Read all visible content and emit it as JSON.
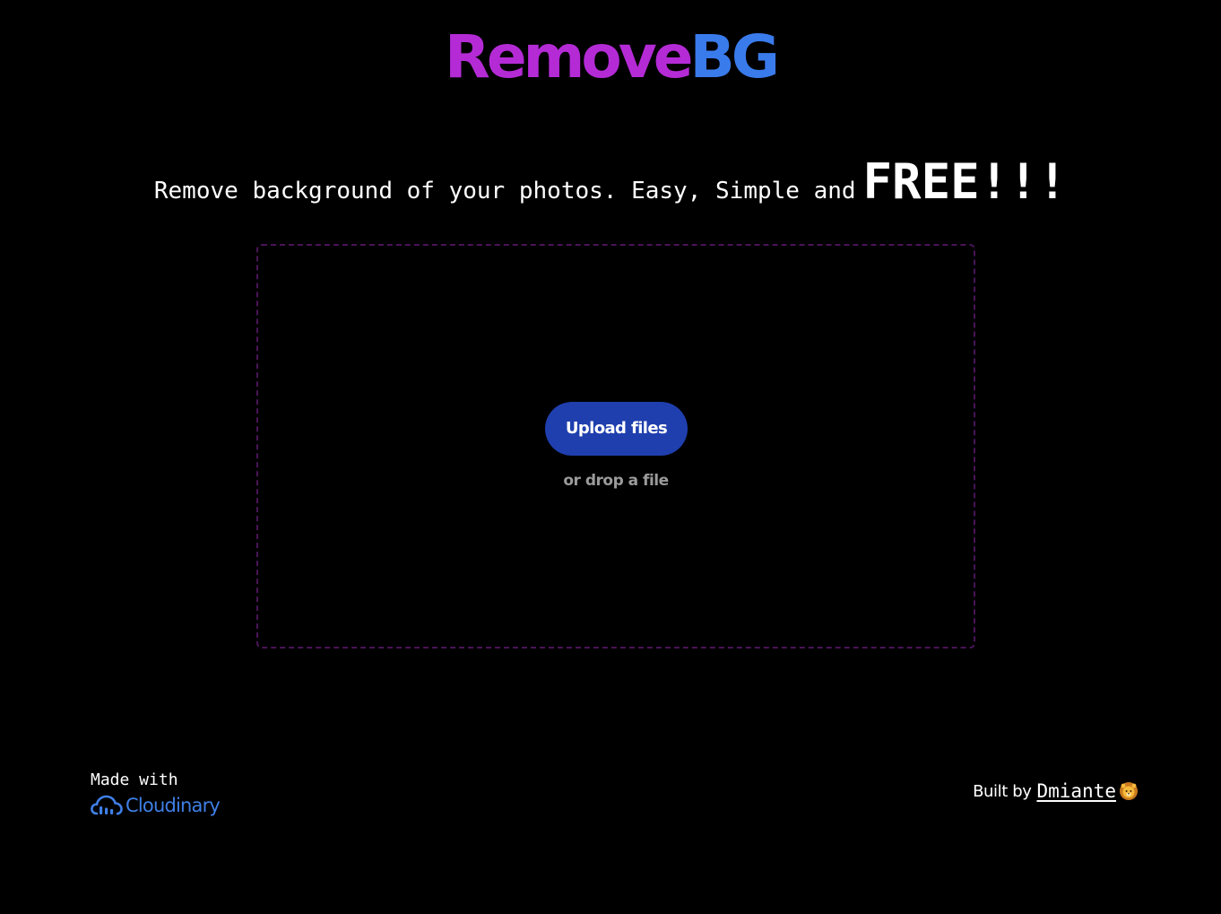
{
  "logo": {
    "part_a": "Remove",
    "part_b": "BG"
  },
  "tagline": {
    "text": "Remove background of your photos. Easy, Simple and",
    "emphasis": "FREE!!!"
  },
  "dropzone": {
    "upload_label": "Upload files",
    "drop_hint": "or drop a file"
  },
  "footer": {
    "made_with_label": "Made with",
    "cloudinary_label": "Cloudinary",
    "cloudinary_icon": "cloudinary-cloud-icon",
    "built_by_label": "Built by",
    "author": "Dmiante",
    "author_icon": "lion-emoji-icon"
  },
  "colors": {
    "background": "#000000",
    "logo_purple": "#b42bd6",
    "logo_blue": "#3a7bec",
    "button": "#1f3fae",
    "dropzone_border": "#4a1457",
    "cloudinary_blue": "#3f7fe6"
  }
}
